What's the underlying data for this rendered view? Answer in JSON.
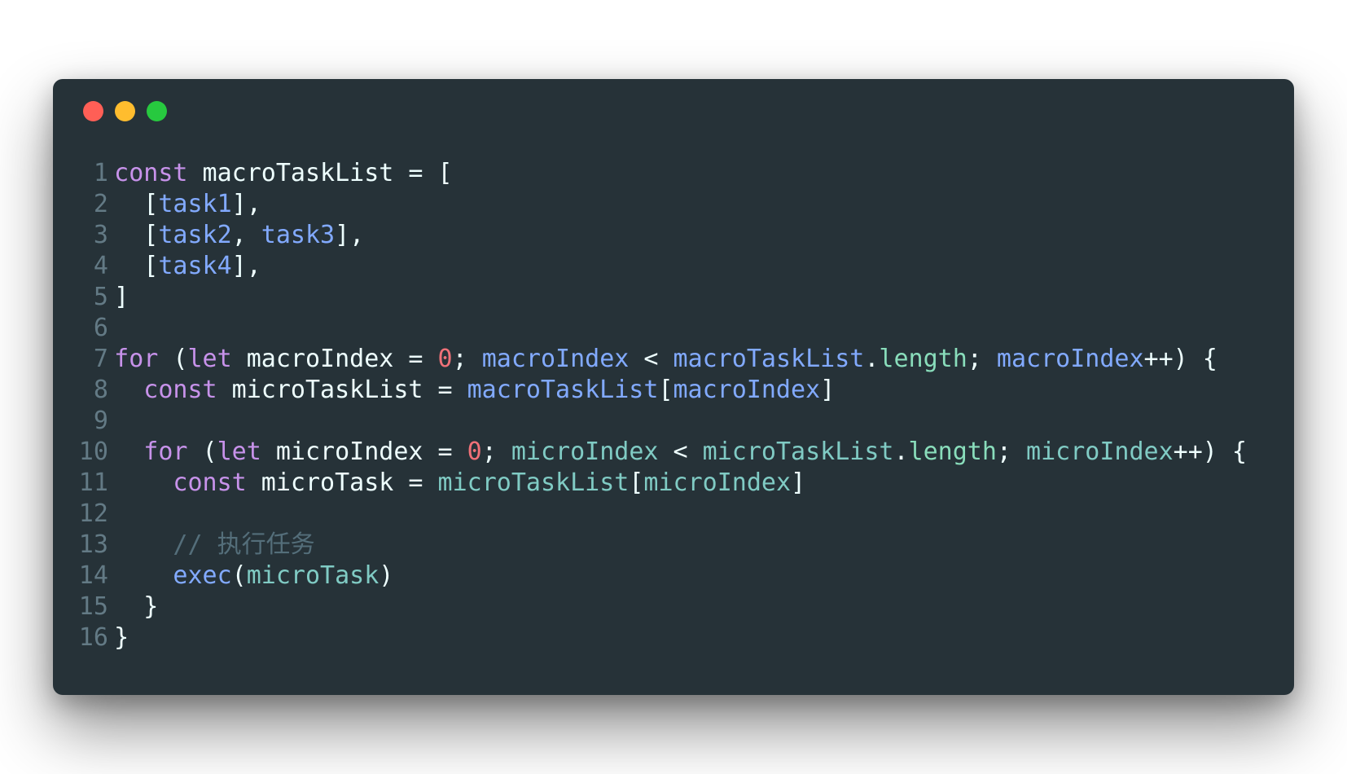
{
  "window": {
    "controls": [
      {
        "name": "close",
        "color": "#ff5f56"
      },
      {
        "name": "minimize",
        "color": "#ffbd2e"
      },
      {
        "name": "maximize",
        "color": "#27c93f"
      }
    ]
  },
  "code": {
    "language": "javascript",
    "lines": [
      {
        "n": "1",
        "tokens": [
          {
            "t": "const",
            "k": "keyword"
          },
          {
            "t": " macroTaskList = [",
            "k": "plain"
          }
        ]
      },
      {
        "n": "2",
        "tokens": [
          {
            "t": "  [",
            "k": "plain"
          },
          {
            "t": "task1",
            "k": "variable"
          },
          {
            "t": "],",
            "k": "plain"
          }
        ]
      },
      {
        "n": "3",
        "tokens": [
          {
            "t": "  [",
            "k": "plain"
          },
          {
            "t": "task2",
            "k": "variable"
          },
          {
            "t": ", ",
            "k": "plain"
          },
          {
            "t": "task3",
            "k": "variable"
          },
          {
            "t": "],",
            "k": "plain"
          }
        ]
      },
      {
        "n": "4",
        "tokens": [
          {
            "t": "  [",
            "k": "plain"
          },
          {
            "t": "task4",
            "k": "variable"
          },
          {
            "t": "],",
            "k": "plain"
          }
        ]
      },
      {
        "n": "5",
        "tokens": [
          {
            "t": "]",
            "k": "plain"
          }
        ]
      },
      {
        "n": "6",
        "tokens": []
      },
      {
        "n": "7",
        "tokens": [
          {
            "t": "for",
            "k": "keyword"
          },
          {
            "t": " (",
            "k": "plain"
          },
          {
            "t": "let",
            "k": "keyword"
          },
          {
            "t": " macroIndex = ",
            "k": "plain"
          },
          {
            "t": "0",
            "k": "number"
          },
          {
            "t": "; ",
            "k": "plain"
          },
          {
            "t": "macroIndex",
            "k": "variable"
          },
          {
            "t": " < ",
            "k": "plain"
          },
          {
            "t": "macroTaskList",
            "k": "variable"
          },
          {
            "t": ".",
            "k": "plain"
          },
          {
            "t": "length",
            "k": "property"
          },
          {
            "t": "; ",
            "k": "plain"
          },
          {
            "t": "macroIndex",
            "k": "variable"
          },
          {
            "t": "++) {",
            "k": "plain"
          }
        ]
      },
      {
        "n": "8",
        "tokens": [
          {
            "t": "  ",
            "k": "plain"
          },
          {
            "t": "const",
            "k": "keyword"
          },
          {
            "t": " microTaskList = ",
            "k": "plain"
          },
          {
            "t": "macroTaskList",
            "k": "variable"
          },
          {
            "t": "[",
            "k": "plain"
          },
          {
            "t": "macroIndex",
            "k": "variable"
          },
          {
            "t": "]",
            "k": "plain"
          }
        ]
      },
      {
        "n": "9",
        "tokens": []
      },
      {
        "n": "10",
        "tokens": [
          {
            "t": "  ",
            "k": "plain"
          },
          {
            "t": "for",
            "k": "keyword"
          },
          {
            "t": " (",
            "k": "plain"
          },
          {
            "t": "let",
            "k": "keyword"
          },
          {
            "t": " microIndex = ",
            "k": "plain"
          },
          {
            "t": "0",
            "k": "number"
          },
          {
            "t": "; ",
            "k": "plain"
          },
          {
            "t": "microIndex",
            "k": "teal"
          },
          {
            "t": " < ",
            "k": "plain"
          },
          {
            "t": "microTaskList",
            "k": "teal"
          },
          {
            "t": ".",
            "k": "plain"
          },
          {
            "t": "length",
            "k": "property"
          },
          {
            "t": "; ",
            "k": "plain"
          },
          {
            "t": "microIndex",
            "k": "teal"
          },
          {
            "t": "++) {",
            "k": "plain"
          }
        ]
      },
      {
        "n": "11",
        "tokens": [
          {
            "t": "    ",
            "k": "plain"
          },
          {
            "t": "const",
            "k": "keyword"
          },
          {
            "t": " microTask = ",
            "k": "plain"
          },
          {
            "t": "microTaskList",
            "k": "teal"
          },
          {
            "t": "[",
            "k": "plain"
          },
          {
            "t": "microIndex",
            "k": "teal"
          },
          {
            "t": "]",
            "k": "plain"
          }
        ]
      },
      {
        "n": "12",
        "tokens": []
      },
      {
        "n": "13",
        "tokens": [
          {
            "t": "    ",
            "k": "plain"
          },
          {
            "t": "// 执行任务",
            "k": "comment"
          }
        ]
      },
      {
        "n": "14",
        "tokens": [
          {
            "t": "    ",
            "k": "plain"
          },
          {
            "t": "exec",
            "k": "function"
          },
          {
            "t": "(",
            "k": "plain"
          },
          {
            "t": "microTask",
            "k": "teal"
          },
          {
            "t": ")",
            "k": "plain"
          }
        ]
      },
      {
        "n": "15",
        "tokens": [
          {
            "t": "  }",
            "k": "plain"
          }
        ]
      },
      {
        "n": "16",
        "tokens": [
          {
            "t": "}",
            "k": "plain"
          }
        ]
      }
    ]
  }
}
